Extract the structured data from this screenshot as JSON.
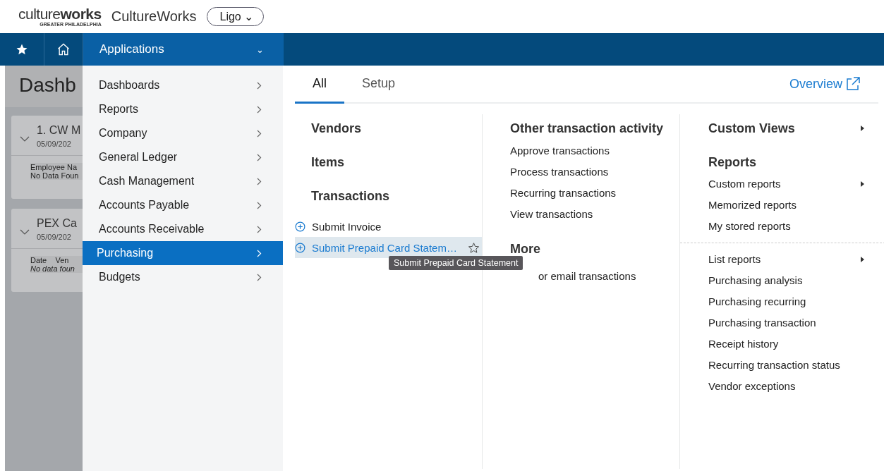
{
  "header": {
    "logo": "culture**works**",
    "logo_sub": "GREATER PHILADELPHIA",
    "company": "CultureWorks",
    "entity": "Ligo ⌄"
  },
  "nav": {
    "applications": "Applications",
    "caret": "⌄"
  },
  "dashboard": {
    "title": "Dashb",
    "cards": [
      {
        "title": "1. CW M",
        "date": "05/09/202",
        "header": "Employee Na",
        "empty": "No Data Foun",
        "italic": false
      },
      {
        "title": "PEX Ca",
        "date": "05/09/202",
        "header": "Date    Ven",
        "empty": "No data foun",
        "italic": true
      }
    ]
  },
  "menu": [
    {
      "label": "Dashboards",
      "selected": false
    },
    {
      "label": "Reports",
      "selected": false
    },
    {
      "label": "Company",
      "selected": false
    },
    {
      "label": "General Ledger",
      "selected": false
    },
    {
      "label": "Cash Management",
      "selected": false
    },
    {
      "label": "Accounts Payable",
      "selected": false
    },
    {
      "label": "Accounts Receivable",
      "selected": false
    },
    {
      "label": "Purchasing",
      "selected": true
    },
    {
      "label": "Budgets",
      "selected": false
    }
  ],
  "tabs": [
    {
      "label": "All",
      "selected": true
    },
    {
      "label": "Setup",
      "selected": false
    }
  ],
  "overview": "Overview",
  "columns": [
    [
      {
        "kind": "heading",
        "label": "Vendors"
      },
      {
        "kind": "heading",
        "label": "Items"
      },
      {
        "kind": "heading",
        "label": "Transactions"
      },
      {
        "kind": "action",
        "label": "Submit Invoice",
        "selected": false
      },
      {
        "kind": "action",
        "label": "Submit Prepaid Card Statem…",
        "selected": true
      }
    ],
    [
      {
        "kind": "heading",
        "label": "Other transaction activity"
      },
      {
        "kind": "link",
        "label": "Approve transactions"
      },
      {
        "kind": "link",
        "label": "Process transactions"
      },
      {
        "kind": "link",
        "label": "Recurring transactions"
      },
      {
        "kind": "link",
        "label": "View transactions"
      },
      {
        "kind": "heading",
        "label": "More"
      },
      {
        "kind": "covered",
        "label": "or email transactions"
      }
    ],
    [
      {
        "kind": "submenu-heading",
        "label": "Custom Views"
      },
      {
        "kind": "heading",
        "label": "Reports"
      },
      {
        "kind": "submenu",
        "label": "Custom reports"
      },
      {
        "kind": "link",
        "label": "Memorized reports"
      },
      {
        "kind": "link",
        "label": "My stored reports"
      },
      {
        "kind": "divider"
      },
      {
        "kind": "submenu",
        "label": "List reports"
      },
      {
        "kind": "link",
        "label": "Purchasing analysis"
      },
      {
        "kind": "link",
        "label": "Purchasing recurring"
      },
      {
        "kind": "link",
        "label": "Purchasing transaction"
      },
      {
        "kind": "link",
        "label": "Receipt history"
      },
      {
        "kind": "link",
        "label": "Recurring transaction status"
      },
      {
        "kind": "link",
        "label": "Vendor exceptions"
      }
    ]
  ],
  "tooltip": "Submit Prepaid Card Statement"
}
